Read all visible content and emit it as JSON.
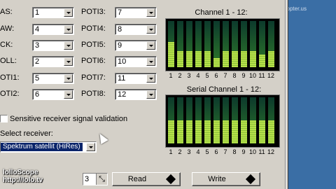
{
  "app": {
    "watermark_line1": "lolloScope",
    "watermark_line2": "http://lolo.tv",
    "url": "http://www.mikrokopter.us"
  },
  "left_labels": [
    "AS:",
    "AW:",
    "CK:",
    "OLL:",
    "OTI1:",
    "OTI2:"
  ],
  "left_values": [
    "1",
    "4",
    "3",
    "2",
    "5",
    "6"
  ],
  "right_labels": [
    "POTI3:",
    "POTI4:",
    "POTI5:",
    "POTI6:",
    "POTI7:",
    "POTI8:"
  ],
  "right_values": [
    "7",
    "8",
    "9",
    "10",
    "11",
    "12"
  ],
  "channel_panel": {
    "title": "Channel 1 - 12:",
    "numbers": [
      "1",
      "2",
      "3",
      "4",
      "5",
      "6",
      "7",
      "8",
      "9",
      "10",
      "11",
      "12"
    ],
    "levels": [
      0.55,
      0.35,
      0.35,
      0.35,
      0.35,
      0.2,
      0.35,
      0.35,
      0.35,
      0.35,
      0.28,
      0.35
    ]
  },
  "serial_panel": {
    "title": "Serial Channel 1 - 12:",
    "numbers": [
      "1",
      "2",
      "3",
      "4",
      "5",
      "6",
      "7",
      "8",
      "9",
      "10",
      "11",
      "12"
    ],
    "levels": [
      0.5,
      0.5,
      0.5,
      0.5,
      0.5,
      0.5,
      0.5,
      0.5,
      0.5,
      0.5,
      0.5,
      0.5
    ]
  },
  "options": {
    "sensitive_label": "Sensitive receiver signal validation",
    "select_receiver_label": "Select receiver:",
    "receiver_value": "Spektrum satellit (HiRes)"
  },
  "bottom": {
    "spin_value": "3",
    "read_label": "Read",
    "write_label": "Write"
  },
  "colors": {
    "window_bg": "#d4d0c8",
    "desktop": "#3a6ea5",
    "bar_dark": "#0c3a2c",
    "bar_mid": "#2f7a2a",
    "bar_light": "#b6e04a"
  }
}
